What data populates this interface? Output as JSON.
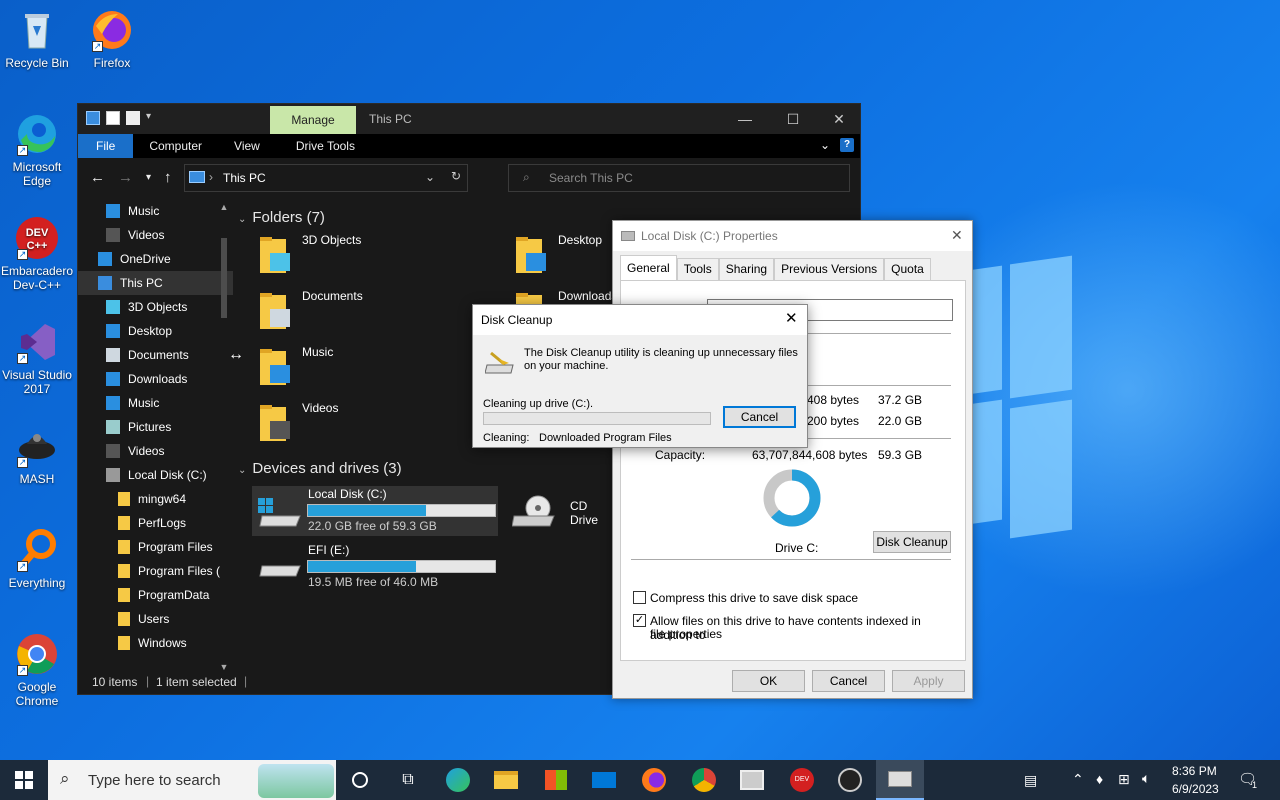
{
  "desktop": {
    "icons": [
      {
        "label": "Recycle Bin",
        "icon": "recycle-bin-icon"
      },
      {
        "label": "Firefox",
        "icon": "firefox-icon"
      },
      {
        "label": "Microsoft Edge",
        "icon": "edge-icon"
      },
      {
        "label": "Embarcadero Dev-C++",
        "icon": "devcpp-icon"
      },
      {
        "label": "Visual Studio 2017",
        "icon": "visual-studio-icon"
      },
      {
        "label": "MASH",
        "icon": "mash-icon"
      },
      {
        "label": "Everything",
        "icon": "everything-icon"
      },
      {
        "label": "Google Chrome",
        "icon": "chrome-icon"
      }
    ]
  },
  "explorer": {
    "manage_tab": "Manage",
    "title": "This PC",
    "ribbon": {
      "file": "File",
      "computer": "Computer",
      "view": "View",
      "drive_tools": "Drive Tools"
    },
    "address": "This PC",
    "search_placeholder": "Search This PC",
    "sidebar": [
      {
        "label": "Music",
        "indent": 1,
        "icon": "music-icon"
      },
      {
        "label": "Videos",
        "indent": 1,
        "icon": "videos-icon"
      },
      {
        "label": "OneDrive",
        "indent": 0,
        "icon": "onedrive-icon"
      },
      {
        "label": "This PC",
        "indent": 0,
        "icon": "pc-icon",
        "selected": true
      },
      {
        "label": "3D Objects",
        "indent": 1,
        "icon": "3d-objects-icon"
      },
      {
        "label": "Desktop",
        "indent": 1,
        "icon": "desktop-icon"
      },
      {
        "label": "Documents",
        "indent": 1,
        "icon": "documents-icon"
      },
      {
        "label": "Downloads",
        "indent": 1,
        "icon": "downloads-icon"
      },
      {
        "label": "Music",
        "indent": 1,
        "icon": "music-icon"
      },
      {
        "label": "Pictures",
        "indent": 1,
        "icon": "pictures-icon"
      },
      {
        "label": "Videos",
        "indent": 1,
        "icon": "videos-icon"
      },
      {
        "label": "Local Disk (C:)",
        "indent": 1,
        "icon": "drive-icon"
      },
      {
        "label": "mingw64",
        "indent": 2,
        "icon": "folder-icon"
      },
      {
        "label": "PerfLogs",
        "indent": 2,
        "icon": "folder-icon"
      },
      {
        "label": "Program Files",
        "indent": 2,
        "icon": "folder-icon"
      },
      {
        "label": "Program Files (",
        "indent": 2,
        "icon": "folder-icon"
      },
      {
        "label": "ProgramData",
        "indent": 2,
        "icon": "folder-icon"
      },
      {
        "label": "Users",
        "indent": 2,
        "icon": "folder-icon"
      },
      {
        "label": "Windows",
        "indent": 2,
        "icon": "folder-icon"
      }
    ],
    "folders_header": "Folders (7)",
    "folders": [
      {
        "label": "3D Objects",
        "icon": "3d-objects-icon"
      },
      {
        "label": "Desktop",
        "icon": "desktop-icon"
      },
      {
        "label": "Documents",
        "icon": "documents-icon"
      },
      {
        "label": "Downloads",
        "icon": "downloads-icon"
      },
      {
        "label": "Music",
        "icon": "music-icon"
      },
      {
        "label": "Videos",
        "icon": "videos-icon"
      }
    ],
    "drives_header": "Devices and drives (3)",
    "drives": [
      {
        "label": "Local Disk (C:)",
        "free": "22.0 GB free of 59.3 GB",
        "used_fraction": 0.63,
        "selected": true
      },
      {
        "label": "EFI (E:)",
        "free": "19.5 MB free of 46.0 MB",
        "used_fraction": 0.58
      },
      {
        "label": "CD Drive",
        "free": ""
      }
    ],
    "status": {
      "items": "10 items",
      "selected": "1 item selected"
    }
  },
  "properties": {
    "title": "Local Disk (C:) Properties",
    "tabs": [
      "General",
      "Tools",
      "Sharing",
      "Previous Versions",
      "Quota"
    ],
    "used_bytes_partial": "408 bytes",
    "used_size": "37.2 GB",
    "free_bytes_partial": "200 bytes",
    "free_size": "22.0 GB",
    "capacity_label": "Capacity:",
    "capacity_bytes": "63,707,844,608 bytes",
    "capacity_size": "59.3 GB",
    "drive_label": "Drive C:",
    "used_fraction": 0.63,
    "disk_cleanup_button": "Disk Cleanup",
    "compress_label": "Compress this drive to save disk space",
    "index_label_1": "Allow files on this drive to have contents indexed in addition to",
    "index_label_2": "file properties",
    "ok": "OK",
    "cancel": "Cancel",
    "apply": "Apply",
    "colors": {
      "used": "#26a0da",
      "free": "#c8c8c8"
    }
  },
  "cleanup": {
    "title": "Disk Cleanup",
    "message_1": "The Disk Cleanup utility is cleaning up unnecessary files",
    "message_2": "on your machine.",
    "progress_label": "Cleaning up drive  (C:).",
    "cancel": "Cancel",
    "cleaning_label": "Cleaning:",
    "cleaning_value": "Downloaded Program Files",
    "progress": 0.0
  },
  "taskbar": {
    "search_placeholder": "Type here to search",
    "time": "8:36 PM",
    "date": "6/9/2023",
    "notification_count": "1"
  }
}
